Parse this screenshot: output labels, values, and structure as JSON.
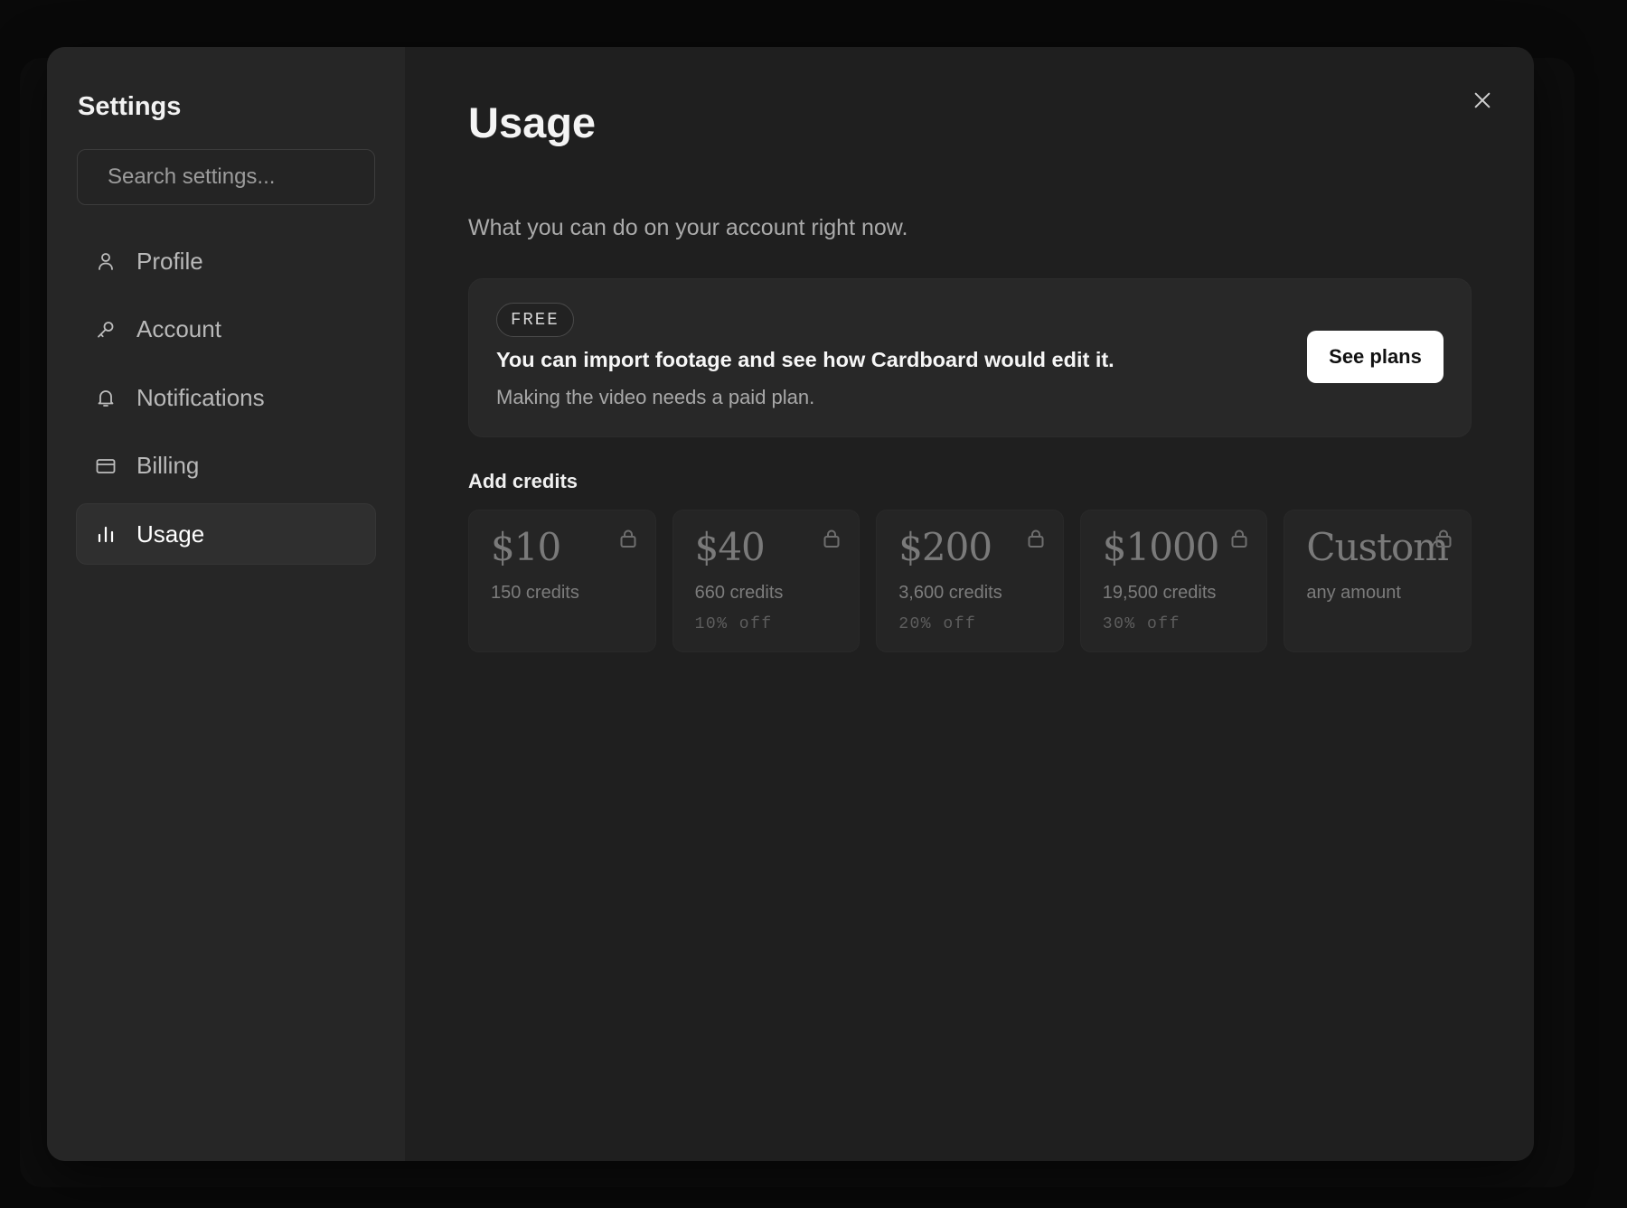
{
  "sidebar": {
    "title": "Settings",
    "search_placeholder": "Search settings...",
    "items": [
      {
        "label": "Profile",
        "icon": "user-icon",
        "active": false
      },
      {
        "label": "Account",
        "icon": "key-icon",
        "active": false
      },
      {
        "label": "Notifications",
        "icon": "bell-icon",
        "active": false
      },
      {
        "label": "Billing",
        "icon": "credit-card-icon",
        "active": false
      },
      {
        "label": "Usage",
        "icon": "bar-chart-icon",
        "active": true
      }
    ]
  },
  "main": {
    "title": "Usage",
    "subtitle": "What you can do on your account right now.",
    "plan": {
      "badge": "FREE",
      "headline": "You can import footage and see how Cardboard would edit it.",
      "description": "Making the video needs a paid plan.",
      "button_label": "See plans"
    },
    "credits_section_label": "Add credits",
    "credit_options": [
      {
        "price": "$10",
        "credits": "150 credits",
        "discount": ""
      },
      {
        "price": "$40",
        "credits": "660 credits",
        "discount": "10% off"
      },
      {
        "price": "$200",
        "credits": "3,600 credits",
        "discount": "20% off"
      },
      {
        "price": "$1000",
        "credits": "19,500 credits",
        "discount": "30% off"
      },
      {
        "price": "Custom",
        "credits": "any amount",
        "discount": ""
      }
    ]
  },
  "colors": {
    "modal_bg": "#1f1f1f",
    "sidebar_bg": "#262626",
    "primary_button_bg": "#ffffff",
    "locked_text": "#7a7a7a"
  }
}
